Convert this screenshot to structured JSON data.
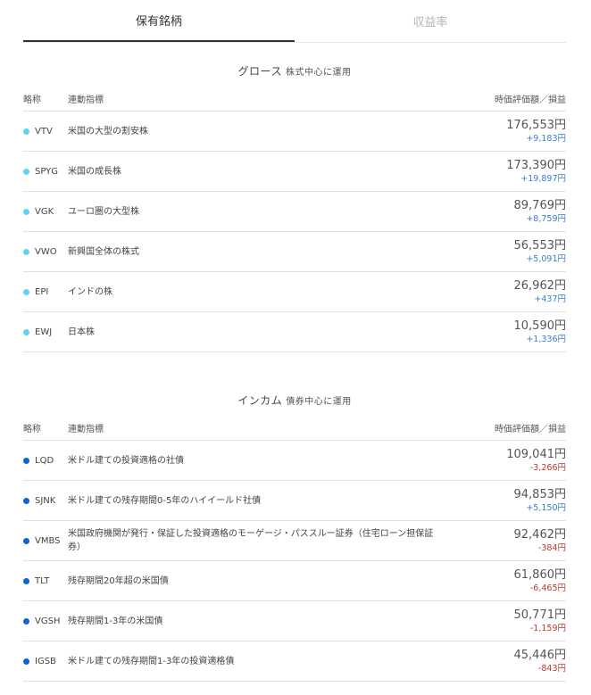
{
  "tabs": [
    {
      "label": "保有銘柄"
    },
    {
      "label": "収益率"
    }
  ],
  "colors": {
    "growth_dot": "#5fd3f3",
    "income_dot": "#0f63d0",
    "gain": "#3a7ecf",
    "loss": "#c0392b"
  },
  "growth": {
    "title": "グロース",
    "subtitle": "株式中心に運用",
    "headers": {
      "abbr": "略称",
      "index": "連動指標",
      "value": "時価評価額／損益"
    },
    "rows": [
      {
        "ticker": "VTV",
        "desc": "米国の大型の割安株",
        "amount": "176,553円",
        "pl": "+9,183円",
        "sign": "gain"
      },
      {
        "ticker": "SPYG",
        "desc": "米国の成長株",
        "amount": "173,390円",
        "pl": "+19,897円",
        "sign": "gain"
      },
      {
        "ticker": "VGK",
        "desc": "ユーロ圏の大型株",
        "amount": "89,769円",
        "pl": "+8,759円",
        "sign": "gain"
      },
      {
        "ticker": "VWO",
        "desc": "新興国全体の株式",
        "amount": "56,553円",
        "pl": "+5,091円",
        "sign": "gain"
      },
      {
        "ticker": "EPI",
        "desc": "インドの株",
        "amount": "26,962円",
        "pl": "+437円",
        "sign": "gain"
      },
      {
        "ticker": "EWJ",
        "desc": "日本株",
        "amount": "10,590円",
        "pl": "+1,336円",
        "sign": "gain"
      }
    ]
  },
  "income": {
    "title": "インカム",
    "subtitle": "債券中心に運用",
    "headers": {
      "abbr": "略称",
      "index": "連動指標",
      "value": "時価評価額／損益"
    },
    "rows": [
      {
        "ticker": "LQD",
        "desc": "米ドル建ての投資適格の社債",
        "amount": "109,041円",
        "pl": "-3,266円",
        "sign": "loss"
      },
      {
        "ticker": "SJNK",
        "desc": "米ドル建ての残存期間0-5年のハイイールド社債",
        "amount": "94,853円",
        "pl": "+5,150円",
        "sign": "gain"
      },
      {
        "ticker": "VMBS",
        "desc": "米国政府機関が発行・保証した投資適格のモーゲージ・パススルー証券（住宅ローン担保証券）",
        "amount": "92,462円",
        "pl": "-384円",
        "sign": "loss"
      },
      {
        "ticker": "TLT",
        "desc": "残存期間20年超の米国債",
        "amount": "61,860円",
        "pl": "-6,465円",
        "sign": "loss"
      },
      {
        "ticker": "VGSH",
        "desc": "残存期間1-3年の米国債",
        "amount": "50,771円",
        "pl": "-1,159円",
        "sign": "loss"
      },
      {
        "ticker": "IGSB",
        "desc": "米ドル建ての残存期間1-3年の投資適格債",
        "amount": "45,446円",
        "pl": "-843円",
        "sign": "loss"
      }
    ]
  }
}
